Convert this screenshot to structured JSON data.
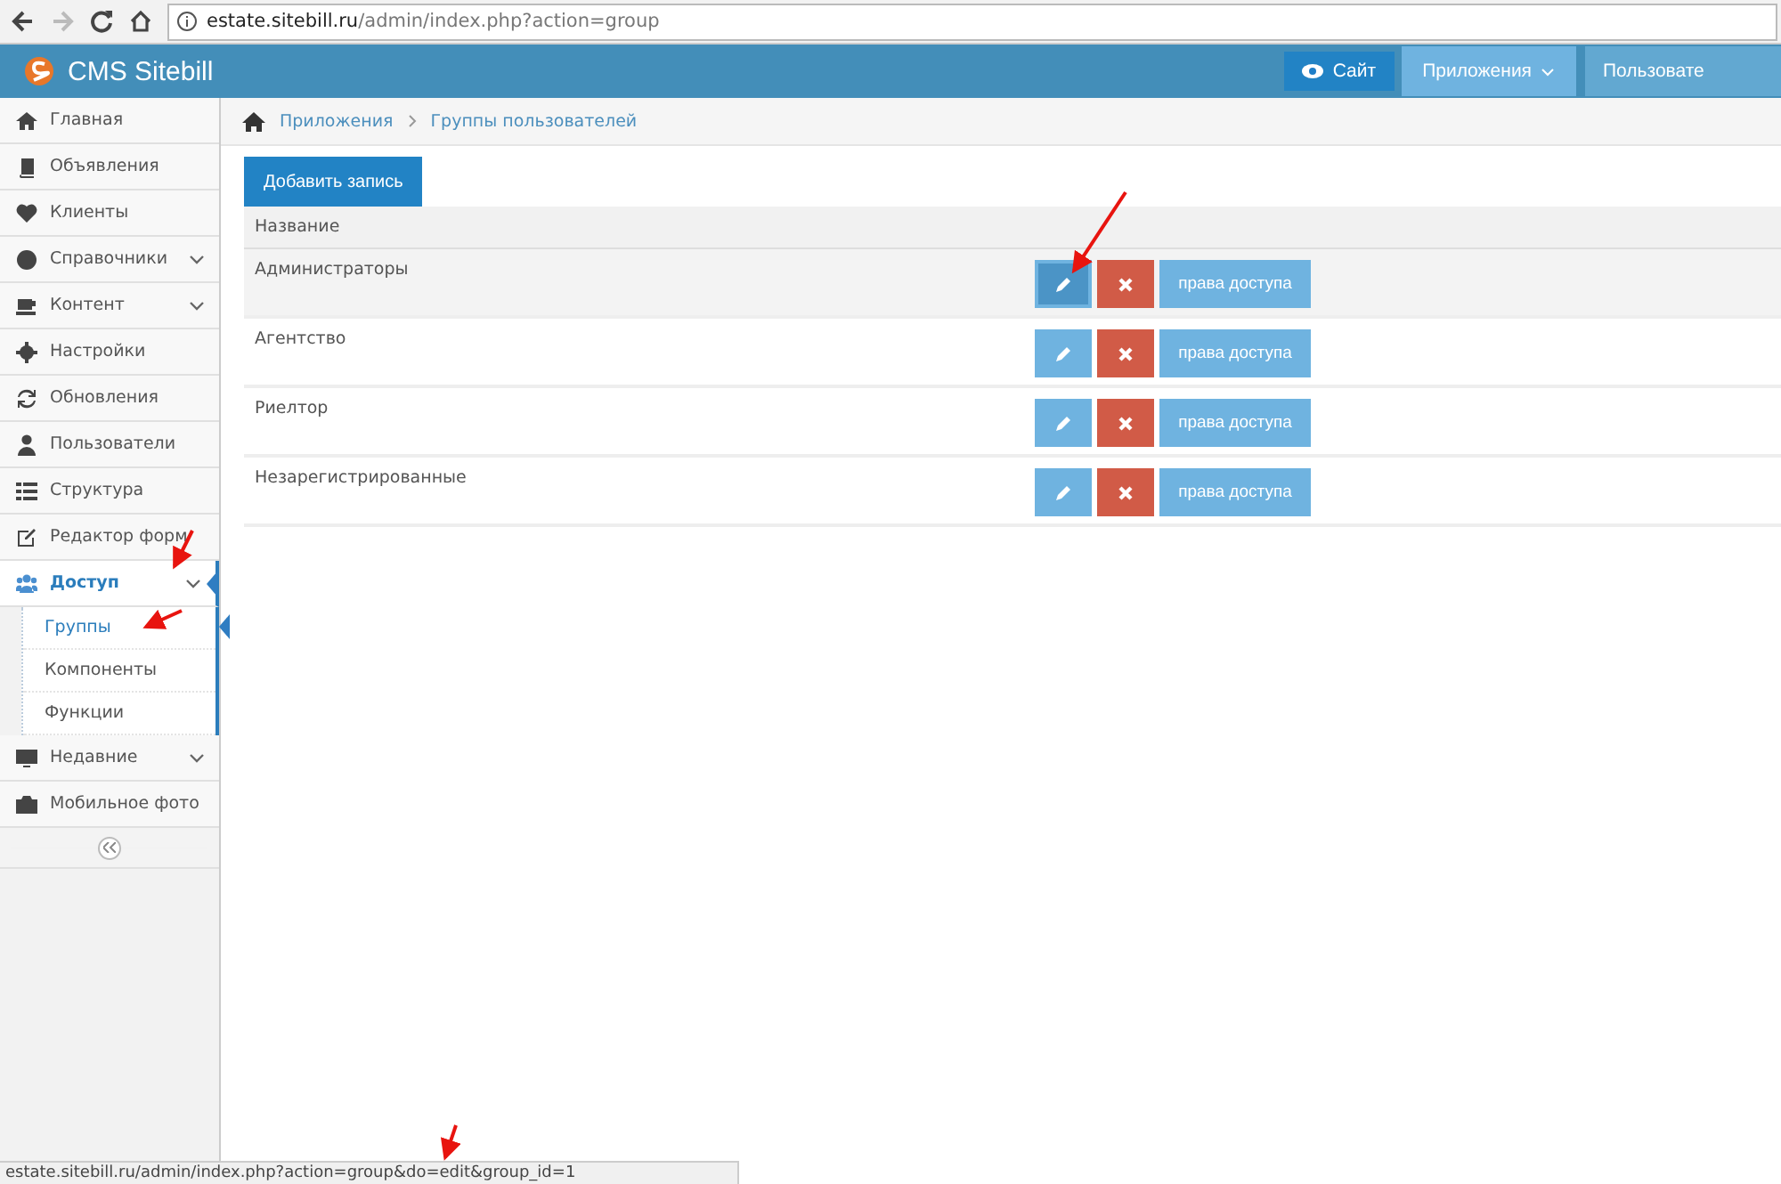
{
  "browser": {
    "url_host": "estate.sitebill.ru",
    "url_path": "/admin/index.php?action=group"
  },
  "header": {
    "brand": "CMS Sitebill",
    "buttons": [
      {
        "label": "Сайт",
        "kind": "site"
      },
      {
        "label": "Приложения",
        "kind": "apps"
      },
      {
        "label": "Пользовате",
        "kind": "user"
      }
    ]
  },
  "sidebar": {
    "items": [
      {
        "label": "Главная",
        "has_submenu": false,
        "selected": false
      },
      {
        "label": "Объявления",
        "has_submenu": false,
        "selected": false
      },
      {
        "label": "Клиенты",
        "has_submenu": false,
        "selected": false
      },
      {
        "label": "Справочники",
        "has_submenu": true,
        "selected": false
      },
      {
        "label": "Контент",
        "has_submenu": true,
        "selected": false
      },
      {
        "label": "Настройки",
        "has_submenu": false,
        "selected": false
      },
      {
        "label": "Обновления",
        "has_submenu": false,
        "selected": false
      },
      {
        "label": "Пользователи",
        "has_submenu": false,
        "selected": false
      },
      {
        "label": "Структура",
        "has_submenu": false,
        "selected": false
      },
      {
        "label": "Редактор форм",
        "has_submenu": false,
        "selected": false
      },
      {
        "label": "Доступ",
        "has_submenu": true,
        "selected": true,
        "children": [
          {
            "label": "Группы",
            "selected": true
          },
          {
            "label": "Компоненты",
            "selected": false
          },
          {
            "label": "Функции",
            "selected": false
          }
        ]
      },
      {
        "label": "Недавние",
        "has_submenu": true,
        "selected": false
      },
      {
        "label": "Мобильное фото",
        "has_submenu": false,
        "selected": false
      }
    ]
  },
  "breadcrumb": [
    "Приложения",
    "Группы пользователей"
  ],
  "add_button": "Добавить запись",
  "table": {
    "columns": [
      "Название"
    ],
    "rows": [
      {
        "name": "Администраторы",
        "highlighted": true,
        "access_button": "права доступа"
      },
      {
        "name": "Агентство",
        "highlighted": false,
        "access_button": "права доступа"
      },
      {
        "name": "Риелтор",
        "highlighted": false,
        "access_button": "права доступа"
      },
      {
        "name": "Незарегистрированные",
        "highlighted": false,
        "access_button": "права доступа"
      }
    ]
  },
  "status_bar": "estate.sitebill.ru/admin/index.php?action=group&do=edit&group_id=1"
}
